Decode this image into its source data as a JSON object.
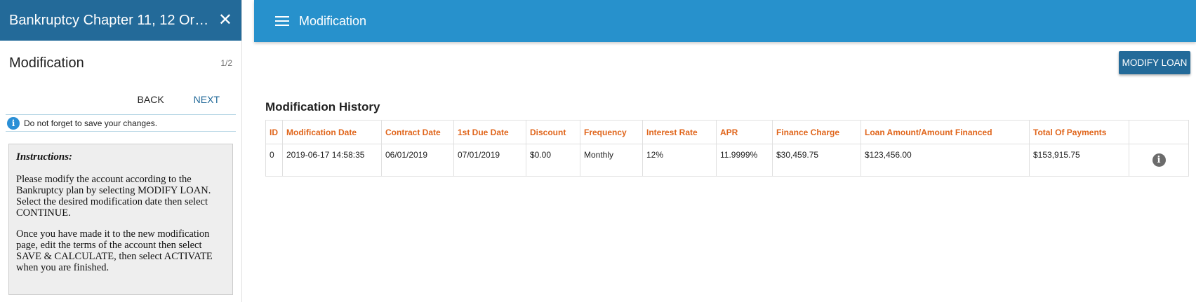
{
  "left_panel": {
    "title": "Bankruptcy Chapter 11, 12 Or 1…",
    "close_icon": "✕",
    "step_title": "Modification",
    "step_count": "1/2",
    "back_label": "BACK",
    "next_label": "NEXT",
    "notice_text": "Do not forget to save your changes.",
    "instructions": {
      "title": "Instructions:",
      "para1": "Please modify the account according to the Bankruptcy plan by selecting MODIFY LOAN. Select the desired modification date then select CONTINUE.",
      "para2": "Once you have made it to the new modification page, edit the terms of the account then select SAVE & CALCULATE, then select ACTIVATE when you are finished."
    }
  },
  "main": {
    "top_title": "Modification",
    "modify_button": "MODIFY LOAN",
    "history_title": "Modification History",
    "columns": [
      "ID",
      "Modification Date",
      "Contract Date",
      "1st Due Date",
      "Discount",
      "Frequency",
      "Interest Rate",
      "APR",
      "Finance Charge",
      "Loan Amount/Amount Financed",
      "Total Of Payments",
      ""
    ],
    "rows": [
      [
        "0",
        "2019-06-17 14:58:35",
        "06/01/2019",
        "07/01/2019",
        "$0.00",
        "Monthly",
        "12%",
        "11.9999%",
        "$30,459.75",
        "$123,456.00",
        "$153,915.75"
      ]
    ]
  },
  "colors": {
    "left_header": "#236a99",
    "top_bar": "#2791cc",
    "accent_text": "#e0651b",
    "button": "#236a99"
  }
}
